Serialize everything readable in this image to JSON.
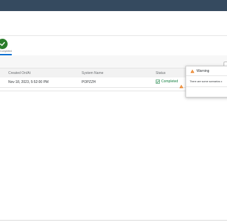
{
  "process": {
    "step_label": "Completed"
  },
  "table": {
    "columns": [
      "Created On/At",
      "System Name",
      "Status"
    ],
    "rows": [
      {
        "created": "Nov 18, 2023, 5:52:00 PM",
        "system": "POPZZH",
        "status": "Completed"
      }
    ]
  },
  "popover": {
    "title": "Warning",
    "message": "There are some scenarios c"
  },
  "icons": {
    "step": "checkmark-icon",
    "status": "checkmark-icon",
    "row_warning": "warning-icon",
    "popover_warning": "warning-icon"
  },
  "colors": {
    "shellbar": "#354a5f",
    "success": "#107e3e",
    "warning": "#e9730c",
    "accent": "#0a6ed1"
  }
}
